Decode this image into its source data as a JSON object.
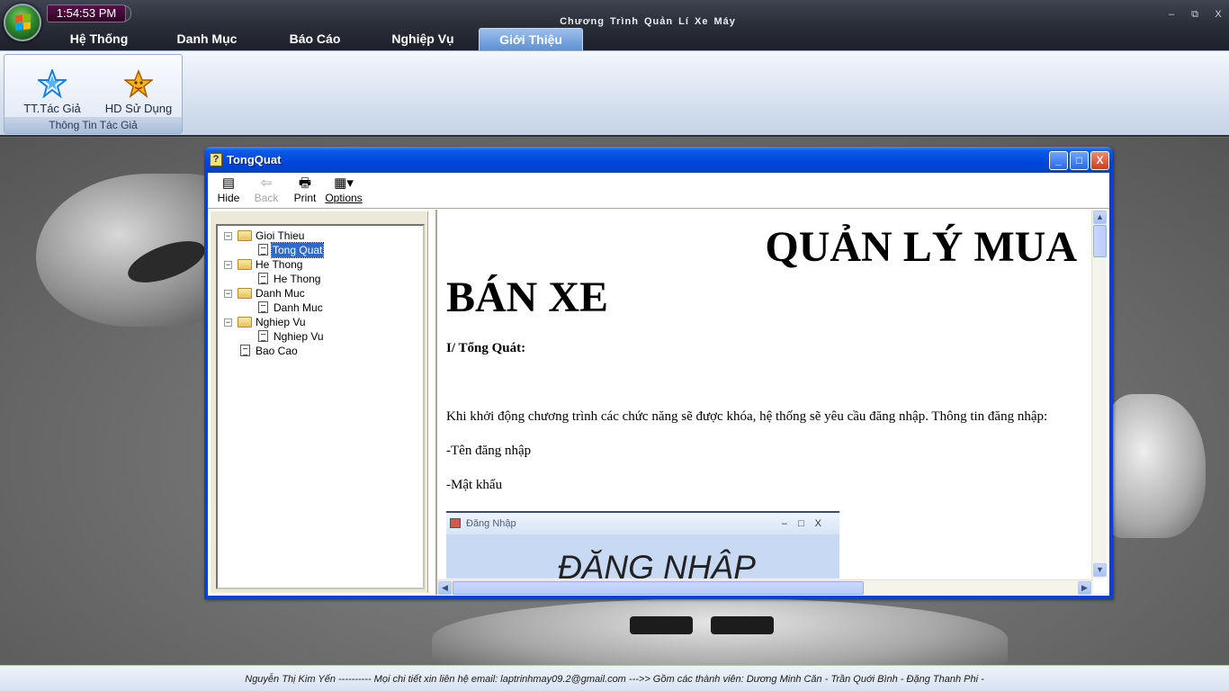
{
  "app": {
    "clock": "1:54:53 PM",
    "title": "Chương Trình Quản Lí Xe Máy",
    "window_controls": {
      "minimize": "–",
      "restore": "⧉",
      "close": "X"
    }
  },
  "tabs": [
    {
      "label": "Hệ Thống",
      "active": false
    },
    {
      "label": "Danh Mục",
      "active": false
    },
    {
      "label": "Báo Cáo",
      "active": false
    },
    {
      "label": "Nghiệp Vụ",
      "active": false
    },
    {
      "label": "Giới Thiệu",
      "active": true
    }
  ],
  "ribbon": {
    "group_label": "Thông Tin Tác Giả",
    "buttons": [
      {
        "label": "TT.Tác Giả",
        "icon": "blue-star-icon"
      },
      {
        "label": "HD Sử Dụng",
        "icon": "gold-star-icon"
      }
    ]
  },
  "help_window": {
    "title": "TongQuat",
    "controls": {
      "minimize": "_",
      "maximize": "□",
      "close": "X"
    },
    "toolbar": {
      "hide": "Hide",
      "back": "Back",
      "print": "Print",
      "options": "Options"
    },
    "tree": [
      {
        "label": "Gioi Thieu",
        "type": "folder"
      },
      {
        "label": "Tong Quat",
        "type": "page",
        "selected": true
      },
      {
        "label": "He Thong",
        "type": "folder"
      },
      {
        "label": "He Thong",
        "type": "page"
      },
      {
        "label": "Danh Muc",
        "type": "folder"
      },
      {
        "label": "Danh Muc",
        "type": "page"
      },
      {
        "label": "Nghiep Vu",
        "type": "folder"
      },
      {
        "label": "Nghiep Vu",
        "type": "page"
      },
      {
        "label": "Bao Cao",
        "type": "page"
      }
    ],
    "content": {
      "heading_line1": "QUẢN LÝ MUA",
      "heading_line2": "BÁN XE",
      "section": "I/ Tổng Quát:",
      "paragraph": "Khi khởi động chương trình các chức năng sẽ được khóa, hệ thống sẽ yêu cầu đăng nhập. Thông tin đăng nhập:",
      "item1": "-Tên đăng nhập",
      "item2": "-Mật khẩu",
      "login_window_title": "Đăng Nhập",
      "login_window_controls": "–□X",
      "login_heading": "ĐĂNG NHẬP"
    }
  },
  "statusbar": {
    "text": "Nguyễn Thị Kim Yến ---------- Mọi chi tiết xin liên hệ email: laptrinhmay09.2@gmail.com --->> Gồm các thành viên: Dương Minh Căn - Trần Quới Bình - Đặng Thanh Phi -"
  }
}
